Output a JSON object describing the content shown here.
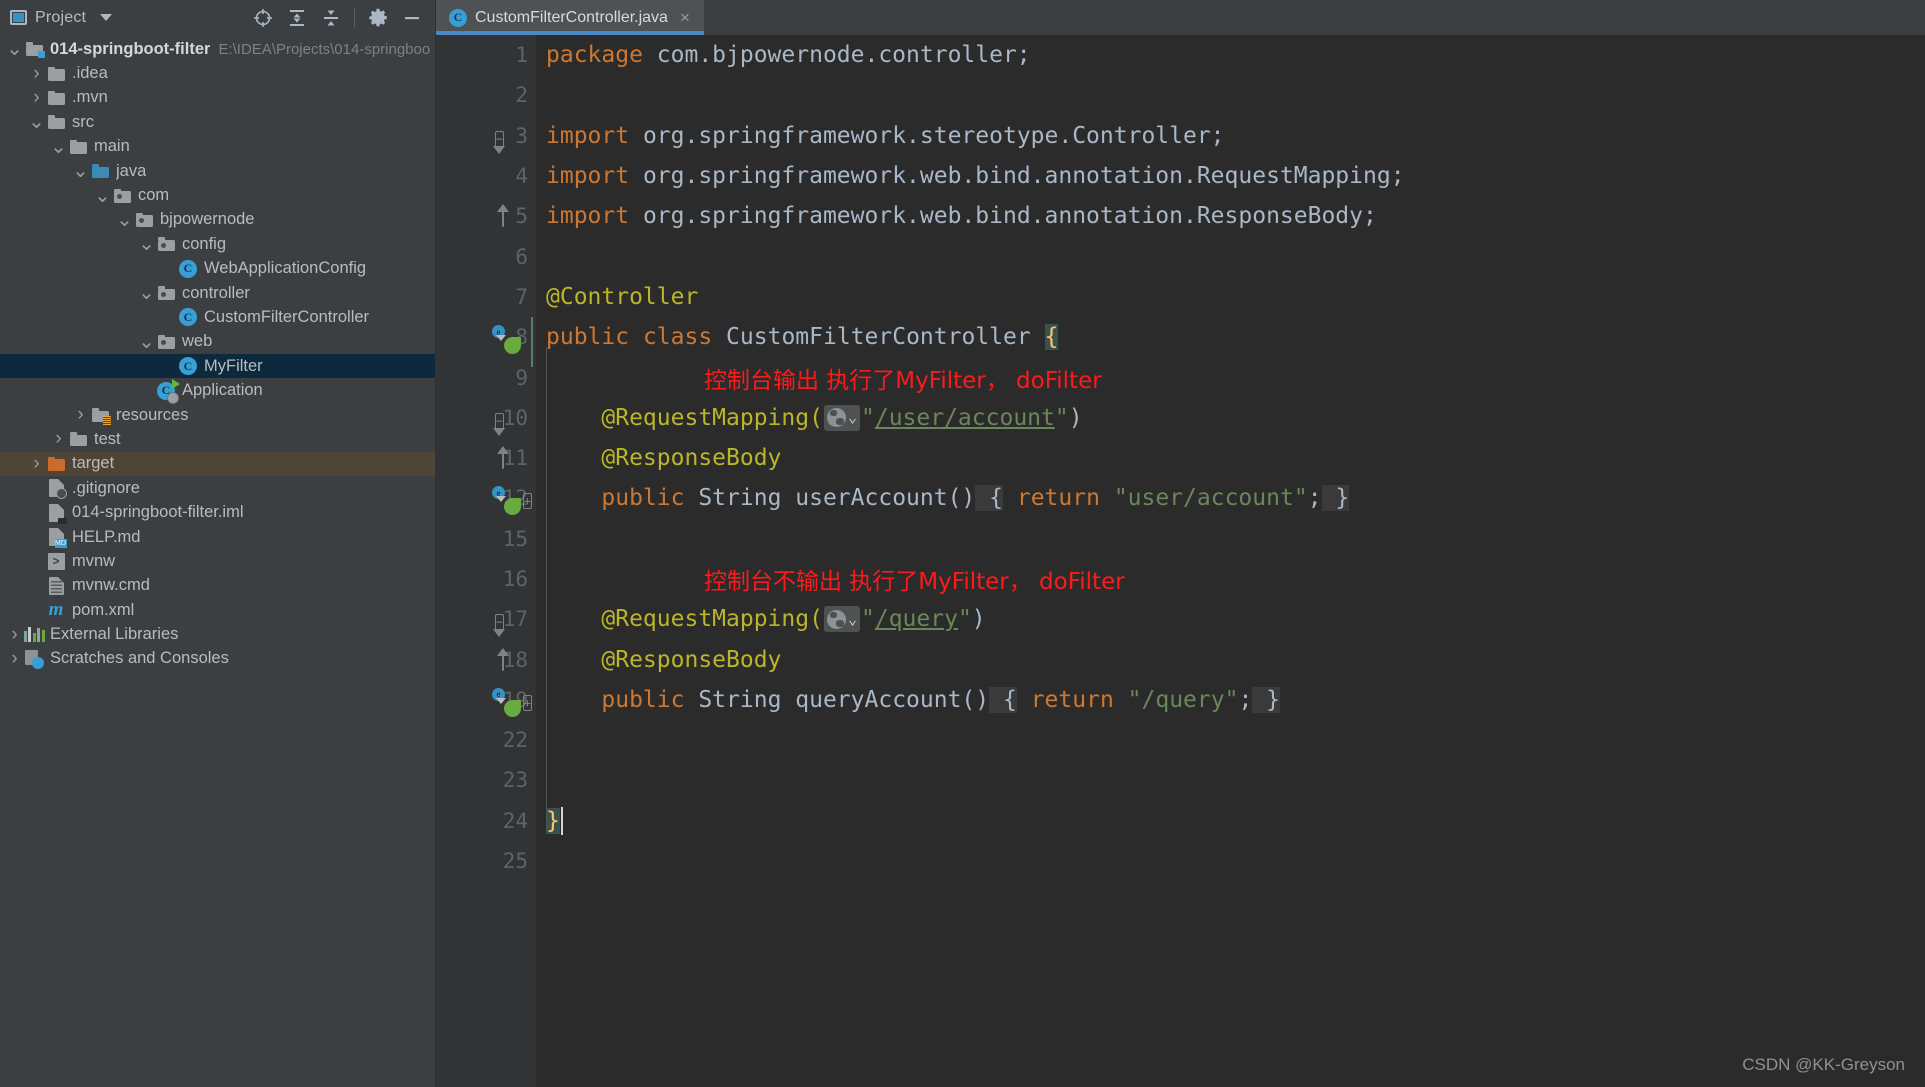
{
  "toolbar": {
    "project_label": "Project",
    "icons": [
      "locate-icon",
      "expand-all-icon",
      "collapse-all-icon",
      "gear-icon",
      "minimize-icon"
    ]
  },
  "tab": {
    "label": "CustomFilterController.java",
    "icon_letter": "C",
    "close_label": "×"
  },
  "tree": {
    "items": [
      {
        "label": "014-springboot-filter",
        "path": "E:\\IDEA\\Projects\\014-springboo",
        "indent": 0,
        "arrow": "v",
        "icon": "module-folder-icon",
        "bold": true
      },
      {
        "label": ".idea",
        "indent": 1,
        "arrow": ">",
        "icon": "folder-icon"
      },
      {
        "label": ".mvn",
        "indent": 1,
        "arrow": ">",
        "icon": "folder-icon"
      },
      {
        "label": "src",
        "indent": 1,
        "arrow": "v",
        "icon": "folder-icon"
      },
      {
        "label": "main",
        "indent": 2,
        "arrow": "v",
        "icon": "folder-icon"
      },
      {
        "label": "java",
        "indent": 3,
        "arrow": "v",
        "icon": "source-root-folder-icon"
      },
      {
        "label": "com",
        "indent": 4,
        "arrow": "v",
        "icon": "package-folder-icon"
      },
      {
        "label": "bjpowernode",
        "indent": 5,
        "arrow": "v",
        "icon": "package-folder-icon"
      },
      {
        "label": "config",
        "indent": 6,
        "arrow": "v",
        "icon": "package-folder-icon"
      },
      {
        "label": "WebApplicationConfig",
        "indent": 7,
        "arrow": "",
        "icon": "java-class-icon"
      },
      {
        "label": "controller",
        "indent": 6,
        "arrow": "v",
        "icon": "package-folder-icon"
      },
      {
        "label": "CustomFilterController",
        "indent": 7,
        "arrow": "",
        "icon": "java-class-icon"
      },
      {
        "label": "web",
        "indent": 6,
        "arrow": "v",
        "icon": "package-folder-icon"
      },
      {
        "label": "MyFilter",
        "indent": 7,
        "arrow": "",
        "icon": "java-class-icon",
        "selected": true
      },
      {
        "label": "Application",
        "indent": 6,
        "arrow": "",
        "icon": "java-runnable-class-icon"
      },
      {
        "label": "resources",
        "indent": 3,
        "arrow": ">",
        "icon": "resources-folder-icon"
      },
      {
        "label": "test",
        "indent": 2,
        "arrow": ">",
        "icon": "folder-icon"
      },
      {
        "label": "target",
        "indent": 1,
        "arrow": ">",
        "icon": "excluded-folder-icon",
        "target": true
      },
      {
        "label": ".gitignore",
        "indent": 1,
        "arrow": "",
        "icon": "gitignore-file-icon"
      },
      {
        "label": "014-springboot-filter.iml",
        "indent": 1,
        "arrow": "",
        "icon": "iml-file-icon"
      },
      {
        "label": "HELP.md",
        "indent": 1,
        "arrow": "",
        "icon": "markdown-file-icon"
      },
      {
        "label": "mvnw",
        "indent": 1,
        "arrow": "",
        "icon": "shell-script-icon"
      },
      {
        "label": "mvnw.cmd",
        "indent": 1,
        "arrow": "",
        "icon": "cmd-script-icon"
      },
      {
        "label": "pom.xml",
        "indent": 1,
        "arrow": "",
        "icon": "maven-pom-icon"
      },
      {
        "label": "External Libraries",
        "indent": 0,
        "arrow": ">",
        "icon": "libraries-icon"
      },
      {
        "label": "Scratches and Consoles",
        "indent": 0,
        "arrow": ">",
        "icon": "scratches-icon"
      }
    ]
  },
  "editor": {
    "line_numbers": [
      "1",
      "2",
      "3",
      "4",
      "5",
      "6",
      "7",
      "8",
      "9",
      "10",
      "11",
      "12",
      "15",
      "16",
      "17",
      "18",
      "19",
      "22",
      "23",
      "24",
      "25"
    ],
    "lines": [
      {
        "n": "1",
        "gutter": "",
        "segments": [
          {
            "t": "package",
            "c": "kw"
          },
          {
            "t": " com.bjpowernode.controller;",
            "c": "white"
          }
        ]
      },
      {
        "n": "2",
        "gutter": "",
        "segments": []
      },
      {
        "n": "3",
        "gutter": "fold-top",
        "segments": [
          {
            "t": "import",
            "c": "kw"
          },
          {
            "t": " org.springframework.stereotype.Controller;",
            "c": "white"
          }
        ]
      },
      {
        "n": "4",
        "gutter": "",
        "segments": [
          {
            "t": "import",
            "c": "kw"
          },
          {
            "t": " org.springframework.web.bind.annotation.RequestMapping;",
            "c": "white"
          }
        ]
      },
      {
        "n": "5",
        "gutter": "fold-bot",
        "segments": [
          {
            "t": "import",
            "c": "kw"
          },
          {
            "t": " org.springframework.web.bind.annotation.ResponseBody;",
            "c": "white"
          }
        ]
      },
      {
        "n": "6",
        "gutter": "",
        "segments": []
      },
      {
        "n": "7",
        "gutter": "",
        "segments": [
          {
            "t": "@Controller",
            "c": "ann"
          }
        ]
      },
      {
        "n": "8",
        "gutter": "spring",
        "segments": [
          {
            "t": "public",
            "c": "kw"
          },
          {
            "t": " ",
            "c": "white"
          },
          {
            "t": "class",
            "c": "kw"
          },
          {
            "t": " CustomFilterController ",
            "c": "white"
          },
          {
            "t": "{",
            "c": "hl-brace"
          }
        ]
      },
      {
        "n": "9",
        "gutter": "",
        "note": "控制台输出 执行了MyFilter， doFilter"
      },
      {
        "n": "10",
        "gutter": "fold-top-sm",
        "segments": [
          {
            "t": "    @RequestMapping(",
            "c": "ann"
          },
          {
            "t": "GLOBE",
            "c": "widget"
          },
          {
            "t": "\"",
            "c": "str"
          },
          {
            "t": "/user/account",
            "c": "url"
          },
          {
            "t": "\"",
            "c": "str"
          },
          {
            "t": ")",
            "c": "white"
          }
        ]
      },
      {
        "n": "11",
        "gutter": "fold-bot-sm",
        "segments": [
          {
            "t": "    @ResponseBody",
            "c": "ann"
          }
        ]
      },
      {
        "n": "12",
        "gutter": "spring-plus",
        "segments": [
          {
            "t": "    ",
            "c": "white"
          },
          {
            "t": "public",
            "c": "kw"
          },
          {
            "t": " String userAccount()",
            "c": "white"
          },
          {
            "t": " ",
            "c": "hl-gray"
          },
          {
            "t": "{",
            "c": "hl-gray"
          },
          {
            "t": " ",
            "c": "white"
          },
          {
            "t": "return",
            "c": "kw"
          },
          {
            "t": " ",
            "c": "white"
          },
          {
            "t": "\"user/account\"",
            "c": "str"
          },
          {
            "t": ";",
            "c": "white"
          },
          {
            "t": " ",
            "c": "hl-gray"
          },
          {
            "t": "}",
            "c": "hl-gray"
          }
        ]
      },
      {
        "n": "15",
        "gutter": "",
        "segments": []
      },
      {
        "n": "16",
        "gutter": "",
        "note": "控制台不输出 执行了MyFilter， doFilter"
      },
      {
        "n": "17",
        "gutter": "fold-top-sm",
        "segments": [
          {
            "t": "    @RequestMapping(",
            "c": "ann"
          },
          {
            "t": "GLOBE",
            "c": "widget"
          },
          {
            "t": "\"",
            "c": "str"
          },
          {
            "t": "/query",
            "c": "url"
          },
          {
            "t": "\"",
            "c": "str"
          },
          {
            "t": ")",
            "c": "white"
          }
        ]
      },
      {
        "n": "18",
        "gutter": "fold-bot-sm",
        "segments": [
          {
            "t": "    @ResponseBody",
            "c": "ann"
          }
        ]
      },
      {
        "n": "19",
        "gutter": "spring-plus",
        "segments": [
          {
            "t": "    ",
            "c": "white"
          },
          {
            "t": "public",
            "c": "kw"
          },
          {
            "t": " String queryAccount()",
            "c": "white"
          },
          {
            "t": " ",
            "c": "hl-gray"
          },
          {
            "t": "{",
            "c": "hl-gray"
          },
          {
            "t": " ",
            "c": "white"
          },
          {
            "t": "return",
            "c": "kw"
          },
          {
            "t": " ",
            "c": "white"
          },
          {
            "t": "\"/query\"",
            "c": "str"
          },
          {
            "t": ";",
            "c": "white"
          },
          {
            "t": " ",
            "c": "hl-gray"
          },
          {
            "t": "}",
            "c": "hl-gray"
          }
        ]
      },
      {
        "n": "22",
        "gutter": "",
        "segments": []
      },
      {
        "n": "23",
        "gutter": "",
        "segments": []
      },
      {
        "n": "24",
        "gutter": "",
        "segments": [
          {
            "t": "}",
            "c": "hl-brace"
          },
          {
            "t": "CARET",
            "c": "caret"
          }
        ]
      },
      {
        "n": "25",
        "gutter": "",
        "segments": []
      }
    ]
  },
  "watermark": "CSDN @KK-Greyson",
  "colors": {
    "keyword": "#cc7832",
    "annotation": "#bbb529",
    "string": "#6a8759",
    "text": "#a9b7c6",
    "note_red": "#ff1a1a",
    "editor_bg": "#2b2b2b",
    "panel_bg": "#3c3f41",
    "tab_active_underline": "#4a88c7",
    "selection_bg": "#0d293e"
  }
}
